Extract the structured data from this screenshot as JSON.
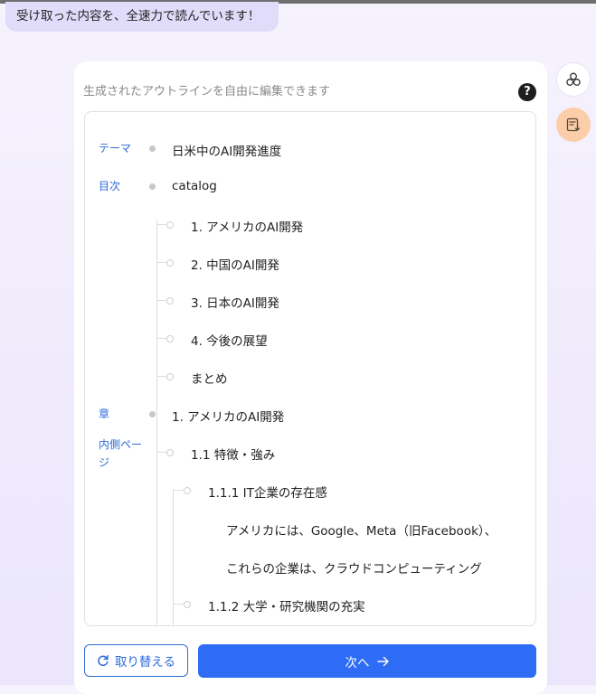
{
  "message": {
    "text": "受け取った内容を、全速力で読んでいます！"
  },
  "card": {
    "title": "生成されたアウトラインを自由に編集できます",
    "help_glyph": "?"
  },
  "labels": {
    "theme": "テーマ",
    "toc": "目次",
    "chapter": "章",
    "inner_page_1": "内側ペー",
    "inner_page_2": "ジ"
  },
  "outline": {
    "theme": "日米中のAI開発進度",
    "toc_title": "catalog",
    "toc_items": [
      "1. アメリカのAI開発",
      "2. 中国のAI開発",
      "3. 日本のAI開発",
      "4. 今後の展望",
      "まとめ"
    ],
    "chapter": "1. アメリカのAI開発",
    "section": "1.1 特徴・強み",
    "subsection_1": "1.1.1 IT企業の存在感",
    "content_1": "アメリカには、Google、Meta（旧Facebook）、",
    "content_2": "これらの企業は、クラウドコンピューティング",
    "subsection_2": "1.1.2 大学・研究機関の充実"
  },
  "buttons": {
    "replace": "取り替える",
    "next": "次へ"
  },
  "icons": {
    "replace": "refresh-icon",
    "next": "arrow-right-icon",
    "help": "question-circle-icon",
    "side_a": "circles-icon",
    "side_b": "document-download-icon"
  },
  "colors": {
    "accent": "#2e6cf6",
    "label_blue": "#2f6ad7",
    "bubble": "#e2dcfb",
    "side_orange": "#fbcda8"
  }
}
